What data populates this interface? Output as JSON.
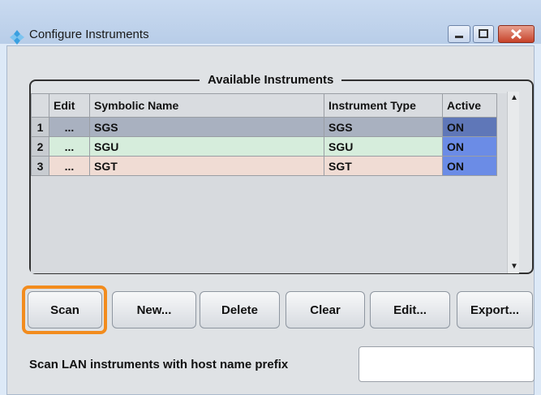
{
  "window": {
    "title": "Configure Instruments",
    "controls": {
      "minimize": "minimize",
      "maximize": "maximize",
      "close": "close"
    }
  },
  "group": {
    "title": "Available Instruments"
  },
  "table": {
    "columns": [
      "",
      "Edit",
      "Symbolic Name",
      "Instrument Type",
      "Active"
    ],
    "rows": [
      {
        "num": "1",
        "edit": "...",
        "name": "SGS",
        "type": "SGS",
        "active": "ON"
      },
      {
        "num": "2",
        "edit": "...",
        "name": "SGU",
        "type": "SGU",
        "active": "ON"
      },
      {
        "num": "3",
        "edit": "...",
        "name": "SGT",
        "type": "SGT",
        "active": "ON"
      }
    ],
    "row_colors": [
      "#a9b1c0",
      "#d6eddc",
      "#f0dcd4"
    ],
    "active_color": "#6b8ce6"
  },
  "buttons": {
    "scan": "Scan",
    "new": "New...",
    "delete": "Delete",
    "clear": "Clear",
    "edit": "Edit...",
    "export": "Export..."
  },
  "prefix": {
    "label": "Scan LAN instruments with host name prefix",
    "value": ""
  },
  "colors": {
    "focus": "#f28c1e",
    "title_icon": "#3aa0e0"
  }
}
